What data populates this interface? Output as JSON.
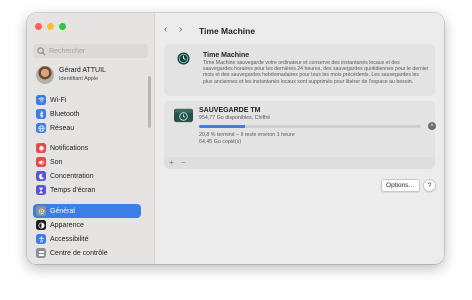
{
  "window": {
    "traffic_lights": {
      "close": "#fe5f57",
      "minimize": "#febc2e",
      "zoom": "#28c840"
    }
  },
  "sidebar": {
    "search_placeholder": "Rechercher",
    "profile": {
      "name": "Gérard ATTUIL",
      "subtitle": "Identifiant Apple"
    },
    "items": [
      {
        "label": "Wi-Fi",
        "icon": "wifi-icon",
        "color": "#3d7ee6"
      },
      {
        "label": "Bluetooth",
        "icon": "bluetooth-icon",
        "color": "#3d7ee6"
      },
      {
        "label": "Réseau",
        "icon": "globe-icon",
        "color": "#3d7ee6"
      },
      {
        "label": "Notifications",
        "icon": "bell-icon",
        "color": "#e54b4b"
      },
      {
        "label": "Son",
        "icon": "speaker-icon",
        "color": "#e54b4b"
      },
      {
        "label": "Concentration",
        "icon": "moon-icon",
        "color": "#5b55d6"
      },
      {
        "label": "Temps d'écran",
        "icon": "hourglass-icon",
        "color": "#5b55d6"
      },
      {
        "label": "Général",
        "icon": "gear-icon",
        "color": "#8e8e93",
        "selected": true
      },
      {
        "label": "Apparence",
        "icon": "appearance-icon",
        "color": "#1c1c1e"
      },
      {
        "label": "Accessibilité",
        "icon": "accessibility-icon",
        "color": "#3d7ee6"
      },
      {
        "label": "Centre de contrôle",
        "icon": "control-center-icon",
        "color": "#8e8e93"
      }
    ]
  },
  "toolbar": {
    "title": "Time Machine",
    "back": "‹",
    "forward": "›"
  },
  "time_machine_card": {
    "title": "Time Machine",
    "description": "Time Machine sauvegarde votre ordinateur et conserve des instantanés locaux et des sauvegardes horaires pour les dernières 24 heures, des sauvegardes quotidiennes pour le dernier mois et des sauvegardes hebdomadaires pour tous les mois précédents. Les sauvegardes les plus anciennes et les instantanés locaux sont supprimés pour libérer de l'espace au besoin."
  },
  "backup_disk": {
    "name": "SAUVEGARDE TM",
    "capacity": "954,77 Go disponibles, Chiffré",
    "status": "20,8 % terminé – Il reste environ 1 heure",
    "copied": "64,45 Go copié(s)",
    "progress_percent": 20.8
  },
  "footer": {
    "add": "+",
    "remove": "−"
  },
  "buttons": {
    "options": "Options…",
    "help": "?"
  }
}
